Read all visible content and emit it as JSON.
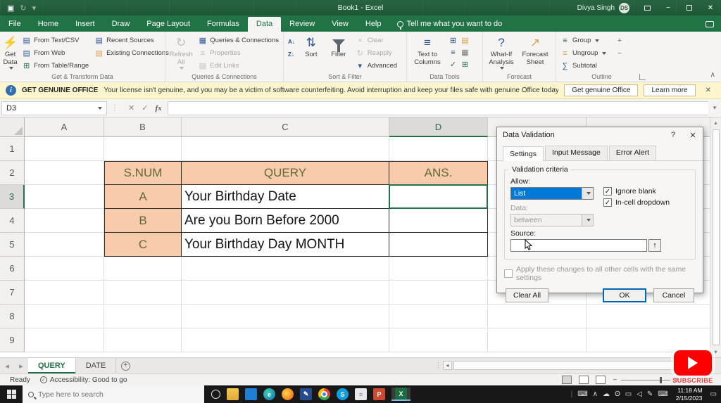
{
  "titlebar": {
    "title": "Book1 - Excel",
    "user": "Divya Singh",
    "avatar_initials": "DS"
  },
  "ribbon": {
    "tabs": [
      {
        "label": "File"
      },
      {
        "label": "Home"
      },
      {
        "label": "Insert"
      },
      {
        "label": "Draw"
      },
      {
        "label": "Page Layout"
      },
      {
        "label": "Formulas"
      },
      {
        "label": "Data"
      },
      {
        "label": "Review"
      },
      {
        "label": "View"
      },
      {
        "label": "Help"
      }
    ],
    "tell_me": "Tell me what you want to do",
    "groups": {
      "get_transform": {
        "label": "Get & Transform Data",
        "get_data": "Get Data",
        "from_text": "From Text/CSV",
        "from_web": "From Web",
        "from_table": "From Table/Range",
        "recent": "Recent Sources",
        "existing": "Existing Connections"
      },
      "queries": {
        "label": "Queries & Connections",
        "refresh_all": "Refresh All",
        "qc": "Queries & Connections",
        "properties": "Properties",
        "edit_links": "Edit Links"
      },
      "sort_filter": {
        "label": "Sort & Filter",
        "sort": "Sort",
        "filter": "Filter",
        "clear": "Clear",
        "reapply": "Reapply",
        "advanced": "Advanced"
      },
      "data_tools": {
        "label": "Data Tools",
        "text_to_columns": "Text to Columns"
      },
      "forecast": {
        "label": "Forecast",
        "what_if": "What-If Analysis",
        "sheet": "Forecast Sheet"
      },
      "outline": {
        "label": "Outline",
        "group": "Group",
        "ungroup": "Ungroup",
        "subtotal": "Subtotal"
      }
    }
  },
  "warning": {
    "title": "GET GENUINE OFFICE",
    "message": "Your license isn't genuine, and you may be a victim of software counterfeiting. Avoid interruption and keep your files safe with genuine Office today.",
    "get_genuine": "Get genuine Office",
    "learn_more": "Learn more"
  },
  "formula_bar": {
    "name_box": "D3",
    "fx": "fx",
    "formula": ""
  },
  "grid": {
    "columns": [
      "A",
      "B",
      "C",
      "D"
    ],
    "rows": [
      "1",
      "2",
      "3",
      "4",
      "5",
      "6",
      "7",
      "8",
      "9"
    ],
    "table": {
      "headers": {
        "snum": "S.NUM",
        "query": "QUERY",
        "ans": "ANS."
      },
      "rows": [
        {
          "snum": "A",
          "query": "Your Birthday Date",
          "ans": ""
        },
        {
          "snum": "B",
          "query": "Are you Born Before 2000",
          "ans": ""
        },
        {
          "snum": "C",
          "query": "Your Birthday Day MONTH",
          "ans": ""
        }
      ]
    }
  },
  "dialog": {
    "title": "Data Validation",
    "help": "?",
    "tabs": [
      {
        "label": "Settings"
      },
      {
        "label": "Input Message"
      },
      {
        "label": "Error Alert"
      }
    ],
    "criteria_label": "Validation criteria",
    "allow_label": "Allow:",
    "allow_value": "List",
    "ignore_blank": "Ignore blank",
    "in_cell_dropdown": "In-cell dropdown",
    "data_label": "Data:",
    "data_value": "between",
    "source_label": "Source:",
    "apply_label": "Apply these changes to all other cells with the same settings",
    "clear_all": "Clear All",
    "ok": "OK",
    "cancel": "Cancel"
  },
  "sheet_tabs": {
    "tabs": [
      {
        "label": "QUERY"
      },
      {
        "label": "DATE"
      }
    ]
  },
  "status_bar": {
    "ready": "Ready",
    "accessibility": "Accessibility: Good to go"
  },
  "taskbar": {
    "search_placeholder": "Type here to search",
    "time": "11:18 AM",
    "date": "2/15/2023"
  },
  "overlay": {
    "subscribe": "SUBSCRIBE"
  },
  "icons": {
    "close": "×",
    "check": "✓",
    "refresh": "↻",
    "lightning": "⚡",
    "sort_arrows": "⇅",
    "up_arrow": "↑",
    "trend": "↗",
    "rows": "≡",
    "grid_sq": "⊞",
    "doc": "▤",
    "table_ic": "▦",
    "dots": "⋮",
    "left": "◂",
    "right": "▸",
    "up_small": "▴",
    "down_small": "▾",
    "plus": "+",
    "minus": "−",
    "chevron_up": "∧",
    "cloud": "☁",
    "keyboard": "⌨",
    "pen": "✎",
    "display": "▭",
    "speaker": "◁",
    "mic": "ʘ",
    "az": "A↓",
    "za": "Z↓",
    "letter_s": "S",
    "letter_p": "P",
    "letter_x": "X",
    "letter_e": "e",
    "save": "▣",
    "maximize": "",
    "sum": "∑",
    "question": "?",
    "win_x": "✕"
  },
  "colors": {
    "excel_green": "#217346",
    "title_green": "#1e5c38",
    "peach": "#f7cbac",
    "header_text": "#5d6b33",
    "accent_blue": "#0078d7",
    "warning_bg": "#fdf5ce",
    "subscribe_red": "#ff0000"
  }
}
